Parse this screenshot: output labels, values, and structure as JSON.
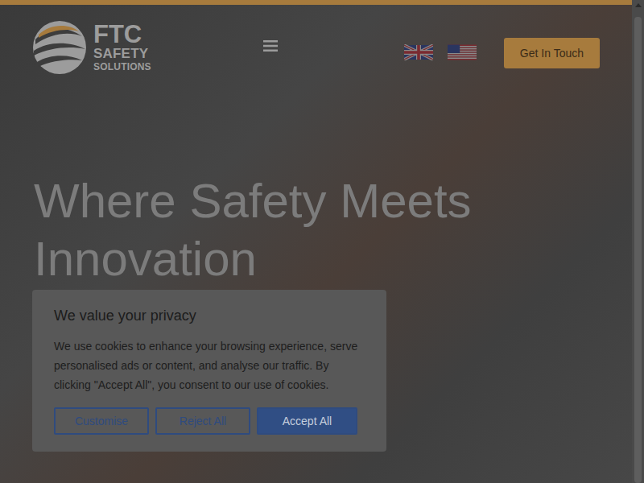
{
  "header": {
    "logo": {
      "lines": [
        "FTC",
        "SAFETY",
        "SOLUTIONS"
      ]
    },
    "button": "Get In Touch"
  },
  "hero": {
    "title": "Where Safety Meets Innovation"
  },
  "cookie_banner": {
    "title": "We value your privacy",
    "text": "We use cookies to enhance your browsing experience, serve personalised ads or content, and analyse our traffic. By clicking \"Accept All\", you consent to our use of cookies.",
    "buttons": [
      {
        "label": "Customise",
        "kind": "outline"
      },
      {
        "label": "Reject All",
        "kind": "outline"
      },
      {
        "label": "Accept All",
        "kind": "filled"
      }
    ]
  }
}
